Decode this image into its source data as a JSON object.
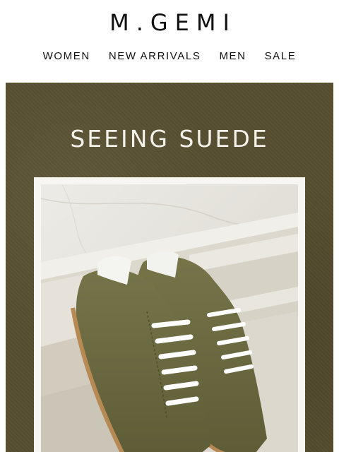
{
  "header": {
    "logo": "M.GEMI"
  },
  "nav": {
    "items": [
      {
        "label": "WOMEN"
      },
      {
        "label": "NEW ARRIVALS"
      },
      {
        "label": "MEN"
      },
      {
        "label": "SALE"
      }
    ]
  },
  "hero": {
    "title": "SEEING SUEDE",
    "image": "olive-suede-sneakers-on-marble-steps",
    "colors": {
      "background": "#574f30",
      "suede": "#6b6a40",
      "marble": "#e4e0d8",
      "frame": "#f7f6f2"
    }
  }
}
